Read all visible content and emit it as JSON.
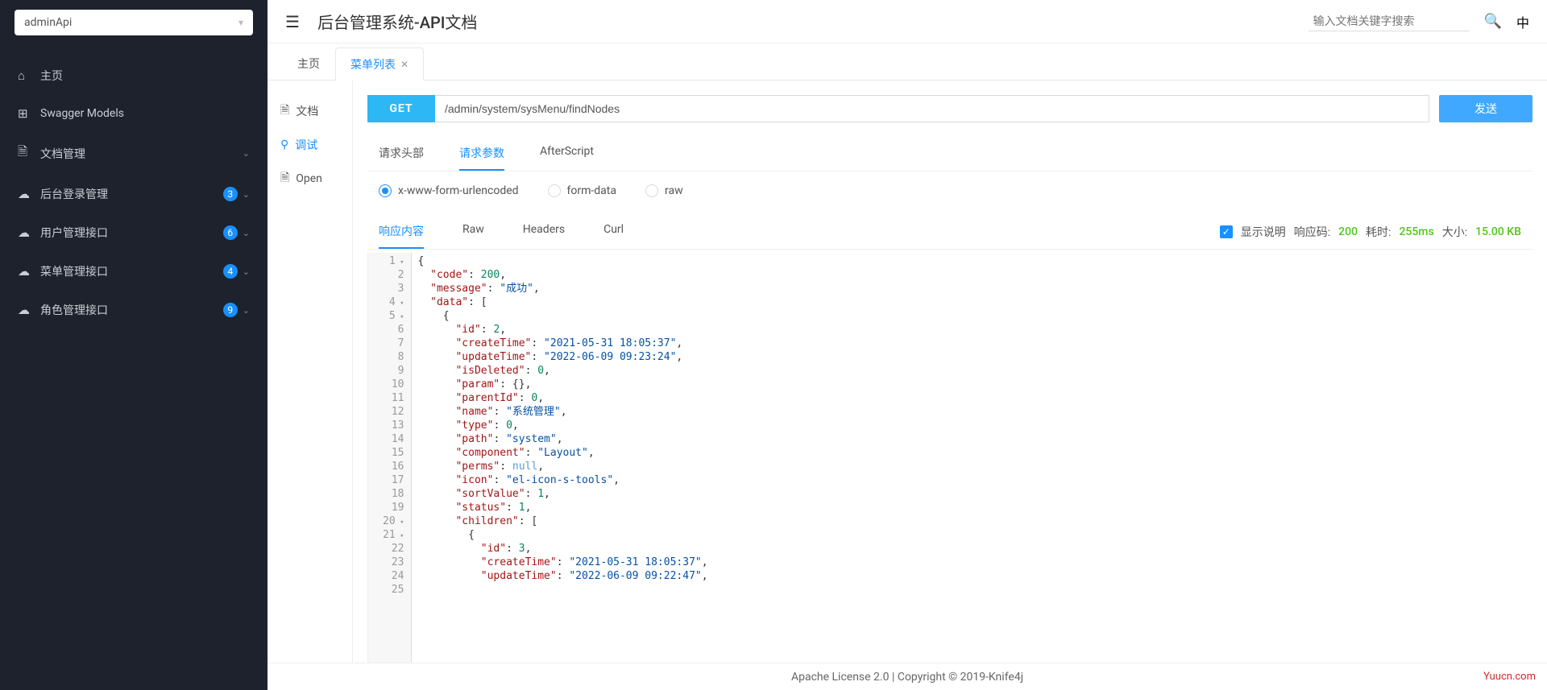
{
  "sidebar": {
    "select_value": "adminApi",
    "items": [
      {
        "icon": "⌂",
        "label": "主页",
        "badge": null,
        "expandable": false
      },
      {
        "icon": "⊞",
        "label": "Swagger Models",
        "badge": null,
        "expandable": false
      },
      {
        "icon": "🗎",
        "label": "文档管理",
        "badge": null,
        "expandable": true
      },
      {
        "icon": "☁",
        "label": "后台登录管理",
        "badge": "3",
        "expandable": true
      },
      {
        "icon": "☁",
        "label": "用户管理接口",
        "badge": "6",
        "expandable": true
      },
      {
        "icon": "☁",
        "label": "菜单管理接口",
        "badge": "4",
        "expandable": true
      },
      {
        "icon": "☁",
        "label": "角色管理接口",
        "badge": "9",
        "expandable": true
      }
    ]
  },
  "header": {
    "title": "后台管理系统-API文档",
    "search_placeholder": "输入文档关键字搜索",
    "lang": "中"
  },
  "tabs": [
    {
      "label": "主页",
      "active": false,
      "closable": false
    },
    {
      "label": "菜单列表",
      "active": true,
      "closable": true
    }
  ],
  "subnav": [
    {
      "icon": "🗎",
      "label": "文档",
      "active": false
    },
    {
      "icon": "⚲",
      "label": "调试",
      "active": true
    },
    {
      "icon": "🗎",
      "label": "Open",
      "active": false
    }
  ],
  "request": {
    "method": "GET",
    "url": "/admin/system/sysMenu/findNodes",
    "send_label": "发送"
  },
  "req_tabs": [
    {
      "label": "请求头部",
      "active": false
    },
    {
      "label": "请求参数",
      "active": true
    },
    {
      "label": "AfterScript",
      "active": false
    }
  ],
  "body_types": [
    {
      "label": "x-www-form-urlencoded",
      "checked": true
    },
    {
      "label": "form-data",
      "checked": false
    },
    {
      "label": "raw",
      "checked": false
    }
  ],
  "resp_tabs": [
    {
      "label": "响应内容",
      "active": true
    },
    {
      "label": "Raw",
      "active": false
    },
    {
      "label": "Headers",
      "active": false
    },
    {
      "label": "Curl",
      "active": false
    }
  ],
  "resp_meta": {
    "show_desc_label": "显示说明",
    "code_label": "响应码:",
    "code_value": "200",
    "time_label": "耗时:",
    "time_value": "255ms",
    "size_label": "大小:",
    "size_value": "15.00 KB"
  },
  "code_lines": [
    {
      "n": 1,
      "fold": true,
      "html": "{"
    },
    {
      "n": 2,
      "fold": false,
      "html": "  <span class='k'>\"code\"</span>: <span class='n'>200</span>,"
    },
    {
      "n": 3,
      "fold": false,
      "html": "  <span class='k'>\"message\"</span>: <span class='s'>\"成功\"</span>,"
    },
    {
      "n": 4,
      "fold": true,
      "html": "  <span class='k'>\"data\"</span>: ["
    },
    {
      "n": 5,
      "fold": true,
      "html": "    {"
    },
    {
      "n": 6,
      "fold": false,
      "html": "      <span class='k'>\"id\"</span>: <span class='n'>2</span>,"
    },
    {
      "n": 7,
      "fold": false,
      "html": "      <span class='k'>\"createTime\"</span>: <span class='s'>\"2021-05-31 18:05:37\"</span>,"
    },
    {
      "n": 8,
      "fold": false,
      "html": "      <span class='k'>\"updateTime\"</span>: <span class='s'>\"2022-06-09 09:23:24\"</span>,"
    },
    {
      "n": 9,
      "fold": false,
      "html": "      <span class='k'>\"isDeleted\"</span>: <span class='n'>0</span>,"
    },
    {
      "n": 10,
      "fold": false,
      "html": "      <span class='k'>\"param\"</span>: {},"
    },
    {
      "n": 11,
      "fold": false,
      "html": "      <span class='k'>\"parentId\"</span>: <span class='n'>0</span>,"
    },
    {
      "n": 12,
      "fold": false,
      "html": "      <span class='k'>\"name\"</span>: <span class='s'>\"系统管理\"</span>,"
    },
    {
      "n": 13,
      "fold": false,
      "html": "      <span class='k'>\"type\"</span>: <span class='n'>0</span>,"
    },
    {
      "n": 14,
      "fold": false,
      "html": "      <span class='k'>\"path\"</span>: <span class='s'>\"system\"</span>,"
    },
    {
      "n": 15,
      "fold": false,
      "html": "      <span class='k'>\"component\"</span>: <span class='s'>\"Layout\"</span>,"
    },
    {
      "n": 16,
      "fold": false,
      "html": "      <span class='k'>\"perms\"</span>: <span class='nl'>null</span>,"
    },
    {
      "n": 17,
      "fold": false,
      "html": "      <span class='k'>\"icon\"</span>: <span class='s'>\"el-icon-s-tools\"</span>,"
    },
    {
      "n": 18,
      "fold": false,
      "html": "      <span class='k'>\"sortValue\"</span>: <span class='n'>1</span>,"
    },
    {
      "n": 19,
      "fold": false,
      "html": "      <span class='k'>\"status\"</span>: <span class='n'>1</span>,"
    },
    {
      "n": 20,
      "fold": true,
      "html": "      <span class='k'>\"children\"</span>: ["
    },
    {
      "n": 21,
      "fold": true,
      "html": "        {"
    },
    {
      "n": 22,
      "fold": false,
      "html": "          <span class='k'>\"id\"</span>: <span class='n'>3</span>,"
    },
    {
      "n": 23,
      "fold": false,
      "html": "          <span class='k'>\"createTime\"</span>: <span class='s'>\"2021-05-31 18:05:37\"</span>,"
    },
    {
      "n": 24,
      "fold": false,
      "html": "          <span class='k'>\"updateTime\"</span>: <span class='s'>\"2022-06-09 09:22:47\"</span>,"
    },
    {
      "n": 25,
      "fold": false,
      "html": "          "
    }
  ],
  "footer": {
    "text": "Apache License 2.0 | Copyright © 2019-Knife4j",
    "attribution": "Yuucn.com"
  }
}
